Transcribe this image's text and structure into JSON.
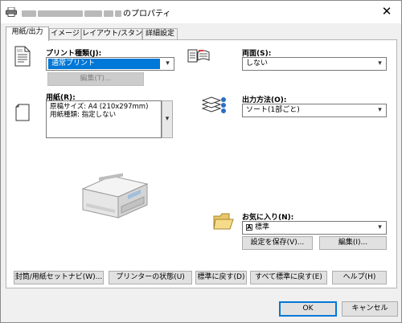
{
  "window": {
    "title_suffix": "のプロパティ",
    "close_glyph": "✕",
    "printer_icon": "printer-icon"
  },
  "tabs": [
    {
      "label": "用紙/出力"
    },
    {
      "label": "イメージ"
    },
    {
      "label": "レイアウト/スタンプ"
    },
    {
      "label": "詳細設定"
    }
  ],
  "print_type": {
    "label": "プリント種類(J):",
    "value": "通常プリント",
    "edit_button": "編集(T)..."
  },
  "paper": {
    "label": "用紙(R):",
    "line1": "原稿サイズ: A4 (210x297mm)",
    "line2": "用紙種類: 指定しない"
  },
  "duplex": {
    "label": "両面(S):",
    "value": "しない"
  },
  "output": {
    "label": "出力方法(O):",
    "value": "ソート(1部ごと)"
  },
  "favorites": {
    "label": "お気に入り(N):",
    "value": "標準",
    "save_button": "設定を保存(V)...",
    "edit_button": "編集(I)..."
  },
  "bottom_buttons": {
    "envelope": "封筒/用紙セットナビ(W)...",
    "status": "プリンターの状態(U)",
    "restore_default": "標準に戻す(D)",
    "restore_all": "すべて標準に戻す(E)",
    "help": "ヘルプ(H)"
  },
  "dialog_buttons": {
    "ok": "OK",
    "cancel": "キャンセル"
  },
  "icons": {
    "dropdown_arrow": "▾",
    "spin_arrow": "▾",
    "favorite_badge": "A"
  }
}
